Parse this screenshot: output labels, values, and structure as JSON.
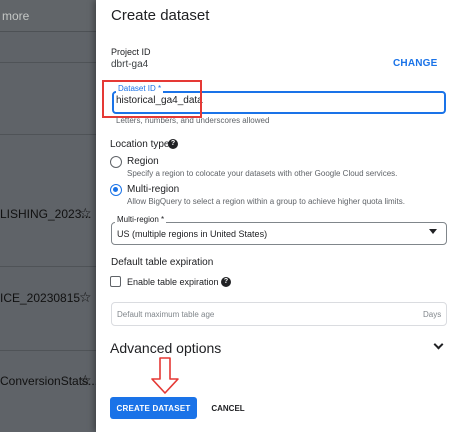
{
  "explorer": {
    "search_placeholder": "more",
    "rows": [
      {
        "label": "LISHING_2023..."
      },
      {
        "label": "ICE_20230815"
      },
      {
        "label": "ConversionStats..."
      }
    ],
    "star_icon": "star-outline-icon"
  },
  "dialog": {
    "title": "Create dataset",
    "project": {
      "label": "Project ID",
      "value": "dbrt-ga4",
      "change_label": "CHANGE"
    },
    "dataset": {
      "label": "Dataset ID *",
      "value": "historical_ga4_data",
      "hint": "Letters, numbers, and underscores allowed"
    },
    "location": {
      "title": "Location type",
      "options": [
        {
          "label": "Region",
          "desc": "Specify a region to colocate your datasets with other Google Cloud services.",
          "selected": false
        },
        {
          "label": "Multi-region",
          "desc": "Allow BigQuery to select a region within a group to achieve higher quota limits.",
          "selected": true
        }
      ],
      "multi_region": {
        "label": "Multi-region *",
        "value": "US (multiple regions in United States)"
      }
    },
    "expiration": {
      "title": "Default table expiration",
      "checkbox_label": "Enable table expiration",
      "checked": false,
      "age_placeholder": "Default maximum table age",
      "age_unit": "Days"
    },
    "advanced": {
      "title": "Advanced options"
    },
    "actions": {
      "create_label": "CREATE DATASET",
      "cancel_label": "CANCEL"
    }
  },
  "colors": {
    "accent": "#1a73e8",
    "annotation": "#e53935",
    "overlay": "#5f6368"
  }
}
